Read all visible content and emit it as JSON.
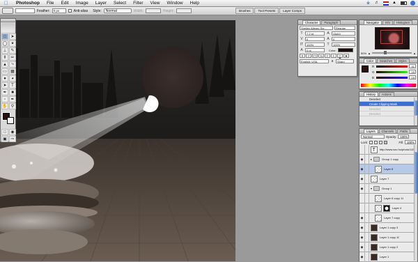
{
  "menubar": {
    "app": "Photoshop",
    "items": [
      "File",
      "Edit",
      "Image",
      "Layer",
      "Select",
      "Filter",
      "View",
      "Window",
      "Help"
    ]
  },
  "options": {
    "feather_label": "Feather:",
    "feather_value": "0 px",
    "antialias_label": "Anti-alias",
    "style_label": "Style:",
    "style_value": "Normal",
    "width_label": "Width:",
    "height_label": "Height:",
    "well_tabs": [
      "Brushes",
      "Tool Presets",
      "Layer Comps"
    ]
  },
  "character": {
    "tabs": [
      "Character",
      "Paragraph"
    ],
    "font": "Shelley Allegro Scr...",
    "style": "Regular",
    "size": "7.2 pt",
    "leading": "(Auto)",
    "kerning": "0",
    "tracking": "0",
    "vscale": "100%",
    "hscale": "100%",
    "baseline": "0 pt",
    "color_label": "Color:",
    "language": "English: USA",
    "aa": "Sharp",
    "buttons": [
      "T",
      "T",
      "TT",
      "Tt",
      "T'",
      "T,",
      "T",
      "T"
    ]
  },
  "navigator": {
    "tabs": [
      "Navigator",
      "Info",
      "Histogram"
    ],
    "zoom": "50%"
  },
  "color": {
    "tabs": [
      "Color",
      "Swatches",
      "Styles"
    ],
    "channels": [
      {
        "label": "R",
        "value": "41"
      },
      {
        "label": "G",
        "value": "15"
      },
      {
        "label": "B",
        "value": "15"
      }
    ]
  },
  "history": {
    "tabs": [
      "History",
      "Actions"
    ],
    "items": [
      {
        "label": "Deselect",
        "state": "normal"
      },
      {
        "label": "Create Clipping Mask",
        "state": "selected"
      },
      {
        "label": "Deselect",
        "state": "dim"
      },
      {
        "label": "Deselect",
        "state": "dim"
      }
    ]
  },
  "layers": {
    "tabs": [
      "Layers",
      "Channels",
      "Paths"
    ],
    "blend": "Normal",
    "opacity_label": "Opacity:",
    "opacity": "100%",
    "lock_label": "Lock:",
    "fill_label": "Fill:",
    "fill": "100%",
    "rows": [
      {
        "name": "http://www.sxc.hu/photo/1101...",
        "thumb": "type",
        "eye": false,
        "sel": false,
        "u": false,
        "indent": 0
      },
      {
        "name": "Group 1 copy",
        "thumb": "folder",
        "eye": true,
        "sel": false,
        "u": false,
        "indent": 0,
        "tri": "▸"
      },
      {
        "name": "Layer 8",
        "thumb": "light",
        "eye": true,
        "sel": true,
        "u": false,
        "indent": 1
      },
      {
        "name": "Layer 7",
        "thumb": "light",
        "eye": true,
        "sel": false,
        "u": true,
        "indent": 0
      },
      {
        "name": "Group 1",
        "thumb": "folder",
        "eye": true,
        "sel": false,
        "u": false,
        "indent": 0,
        "tri": "▾"
      },
      {
        "name": "Layer 6 copy 11",
        "thumb": "light",
        "eye": false,
        "sel": false,
        "u": false,
        "indent": 1
      },
      {
        "name": "Layer 4",
        "thumb": "mask",
        "eye": false,
        "sel": false,
        "u": false,
        "indent": 1
      },
      {
        "name": "Layer 7 copy",
        "thumb": "light",
        "eye": true,
        "sel": false,
        "u": false,
        "indent": 1
      },
      {
        "name": "Layer 1 copy 3",
        "thumb": "dark",
        "eye": true,
        "sel": false,
        "u": true,
        "indent": 0
      },
      {
        "name": "Layer 1 copy 10",
        "thumb": "dark",
        "eye": true,
        "sel": false,
        "u": false,
        "indent": 0
      },
      {
        "name": "Layer 1 copy 2",
        "thumb": "dark",
        "eye": true,
        "sel": false,
        "u": false,
        "indent": 0
      },
      {
        "name": "Layer 1",
        "thumb": "dark",
        "eye": true,
        "sel": false,
        "u": false,
        "indent": 0
      }
    ]
  }
}
